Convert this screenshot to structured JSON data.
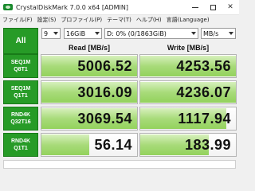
{
  "window": {
    "title": "CrystalDiskMark 7.0.0 x64 [ADMIN]"
  },
  "menu": [
    "ファイル(F)",
    "設定(S)",
    "プロファイル(P)",
    "テーマ(T)",
    "ヘルプ(H)",
    "言語(Language)"
  ],
  "controls": {
    "all_label": "All",
    "count": "9",
    "size": "16GiB",
    "drive": "D: 0% (0/1863GiB)",
    "unit": "MB/s"
  },
  "headers": {
    "read": "Read [MB/s]",
    "write": "Write [MB/s]"
  },
  "rows": [
    {
      "label1": "SEQ1M",
      "label2": "Q8T1",
      "read": "5006.52",
      "write": "4253.56",
      "read_fill": 1.0,
      "write_fill": 1.0
    },
    {
      "label1": "SEQ1M",
      "label2": "Q1T1",
      "read": "3016.09",
      "write": "4236.07",
      "read_fill": 1.0,
      "write_fill": 1.0
    },
    {
      "label1": "RND4K",
      "label2": "Q32T16",
      "read": "3069.54",
      "write": "1117.94",
      "read_fill": 1.0,
      "write_fill": 0.9
    },
    {
      "label1": "RND4K",
      "label2": "Q1T1",
      "read": "56.14",
      "write": "183.99",
      "read_fill": 0.5,
      "write_fill": 0.72
    }
  ],
  "colors": {
    "accent_green": "#279b27",
    "bar_green": "#a8db7a"
  }
}
